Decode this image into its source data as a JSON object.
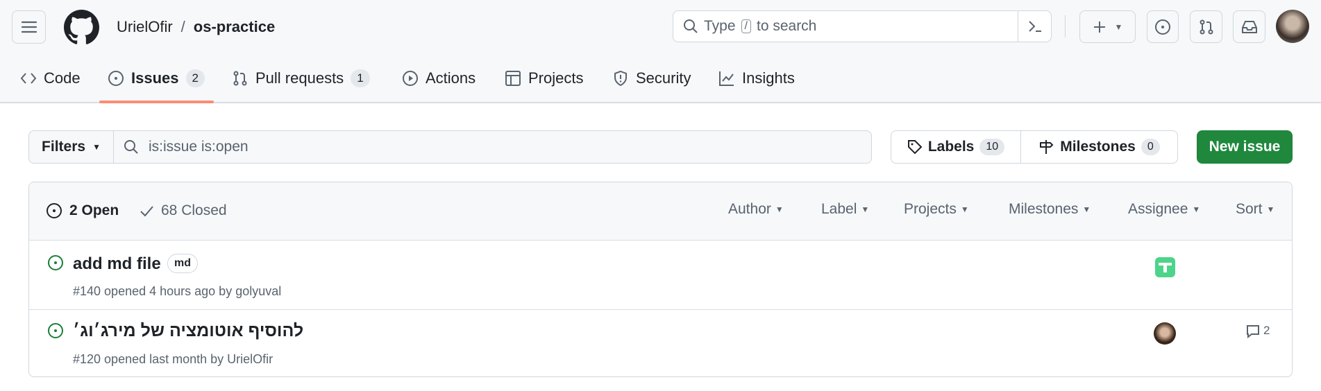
{
  "header": {
    "owner": "UrielOfir",
    "separator": "/",
    "repo": "os-practice",
    "search_prefix": "Type",
    "search_key": "/",
    "search_suffix": "to search"
  },
  "tabs": [
    {
      "label": "Code"
    },
    {
      "label": "Issues",
      "count": "2"
    },
    {
      "label": "Pull requests",
      "count": "1"
    },
    {
      "label": "Actions"
    },
    {
      "label": "Projects"
    },
    {
      "label": "Security"
    },
    {
      "label": "Insights"
    }
  ],
  "toolbar": {
    "filters": "Filters",
    "query": "is:issue is:open",
    "labels": "Labels",
    "labels_count": "10",
    "milestones": "Milestones",
    "milestones_count": "0",
    "new_issue": "New issue"
  },
  "list": {
    "open": "2 Open",
    "closed": "68 Closed",
    "filters": [
      "Author",
      "Label",
      "Projects",
      "Milestones",
      "Assignee",
      "Sort"
    ]
  },
  "issues": [
    {
      "title": "add md file",
      "label": "md",
      "meta": "#140 opened 4 hours ago by golyuval"
    },
    {
      "title": "להוסיף אוטומציה של מירג׳וג׳",
      "meta": "#120 opened last month by UrielOfir",
      "comments": "2"
    }
  ],
  "colors": {
    "accent": "#1f883d",
    "open": "#1a7f37",
    "tab_underline": "#fd8c73"
  }
}
